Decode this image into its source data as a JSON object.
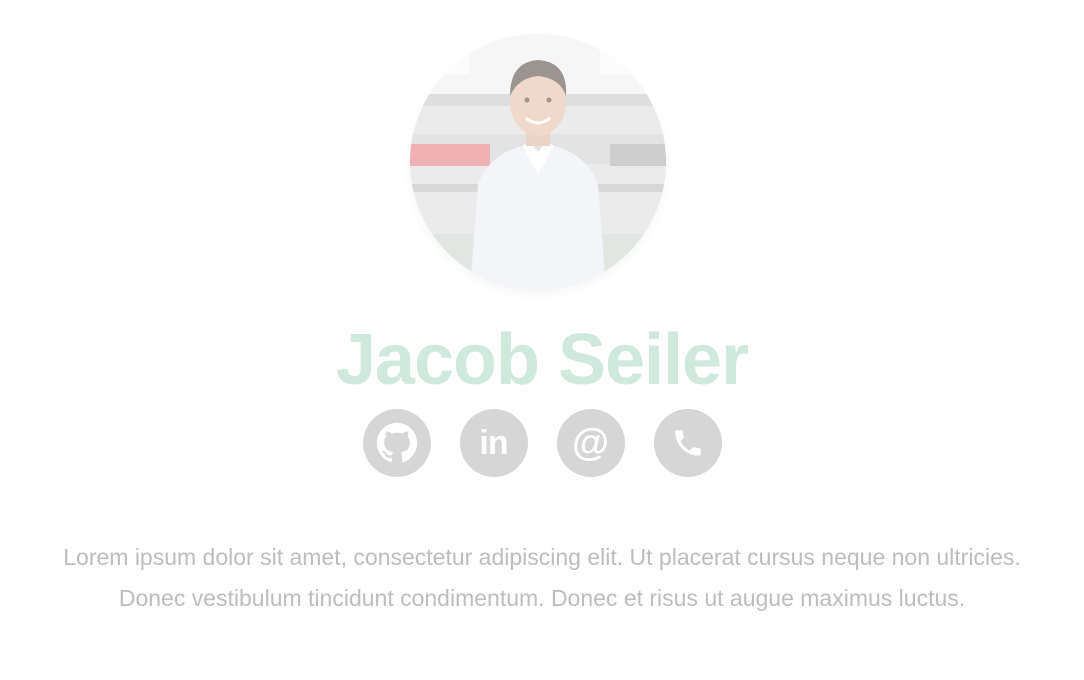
{
  "profile": {
    "name": "Jacob Seiler",
    "bio": "Lorem ipsum dolor sit amet, consectetur adipiscing elit. Ut placerat cursus neque non ultricies. Donec vestibulum tincidunt condimentum. Donec et risus ut augue maximus luctus."
  },
  "socials": [
    {
      "icon": "github-icon"
    },
    {
      "icon": "linkedin-icon",
      "glyph": "in"
    },
    {
      "icon": "email-icon",
      "glyph": "@"
    },
    {
      "icon": "phone-icon"
    }
  ],
  "colors": {
    "name": "#cfe9dc",
    "social_bg": "#d6d6d6",
    "bio_text": "#bdbdbd"
  }
}
